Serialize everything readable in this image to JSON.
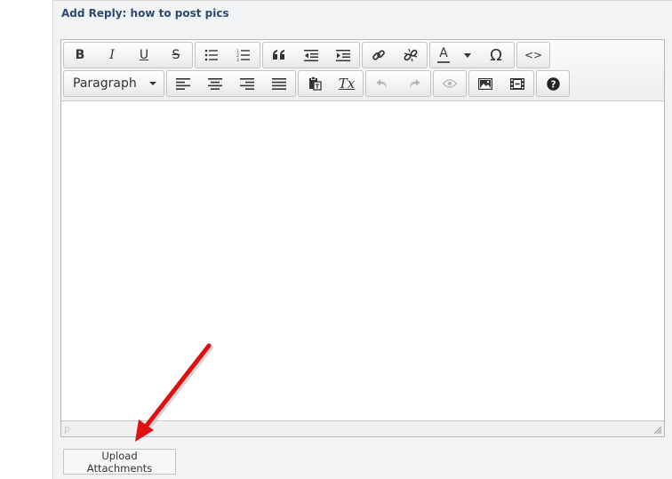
{
  "form": {
    "title": "Add Reply: how to post pics",
    "upload_label": "Upload Attachments"
  },
  "toolbar": {
    "row1": [
      {
        "name": "bold-button",
        "glyph": "B"
      },
      {
        "name": "italic-button",
        "glyph": "I"
      },
      {
        "name": "underline-button",
        "glyph": "U"
      },
      {
        "name": "strikethrough-button",
        "glyph": "S"
      },
      {
        "name": "bullet-list-button",
        "icon": "bullet-list-icon"
      },
      {
        "name": "numbered-list-button",
        "icon": "numbered-list-icon"
      },
      {
        "name": "blockquote-button",
        "icon": "quote-icon"
      },
      {
        "name": "outdent-button",
        "icon": "outdent-icon"
      },
      {
        "name": "indent-button",
        "icon": "indent-icon"
      },
      {
        "name": "insert-link-button",
        "icon": "link-icon"
      },
      {
        "name": "remove-link-button",
        "icon": "unlink-icon"
      },
      {
        "name": "text-color-button",
        "glyph": "A"
      },
      {
        "name": "special-character-button",
        "glyph": "Ω"
      },
      {
        "name": "source-code-button",
        "glyph": "<>"
      }
    ],
    "format_select": {
      "value": "Paragraph"
    },
    "row2": [
      {
        "name": "align-left-button",
        "icon": "align-left-icon"
      },
      {
        "name": "align-center-button",
        "icon": "align-center-icon"
      },
      {
        "name": "align-right-button",
        "icon": "align-right-icon"
      },
      {
        "name": "justify-button",
        "icon": "justify-icon"
      },
      {
        "name": "paste-text-button",
        "icon": "paste-icon"
      },
      {
        "name": "clear-formatting-button",
        "glyph": "Tx"
      },
      {
        "name": "undo-button",
        "icon": "undo-icon",
        "disabled": true
      },
      {
        "name": "redo-button",
        "icon": "redo-icon",
        "disabled": true
      },
      {
        "name": "preview-button",
        "icon": "eye-icon",
        "disabled": true
      },
      {
        "name": "insert-image-button",
        "icon": "image-icon"
      },
      {
        "name": "insert-media-button",
        "icon": "film-icon"
      },
      {
        "name": "help-button",
        "icon": "help-icon"
      }
    ]
  },
  "statusbar": {
    "path": "p"
  },
  "annotation": {
    "color": "#e01010",
    "icon": "red-arrow-icon"
  }
}
